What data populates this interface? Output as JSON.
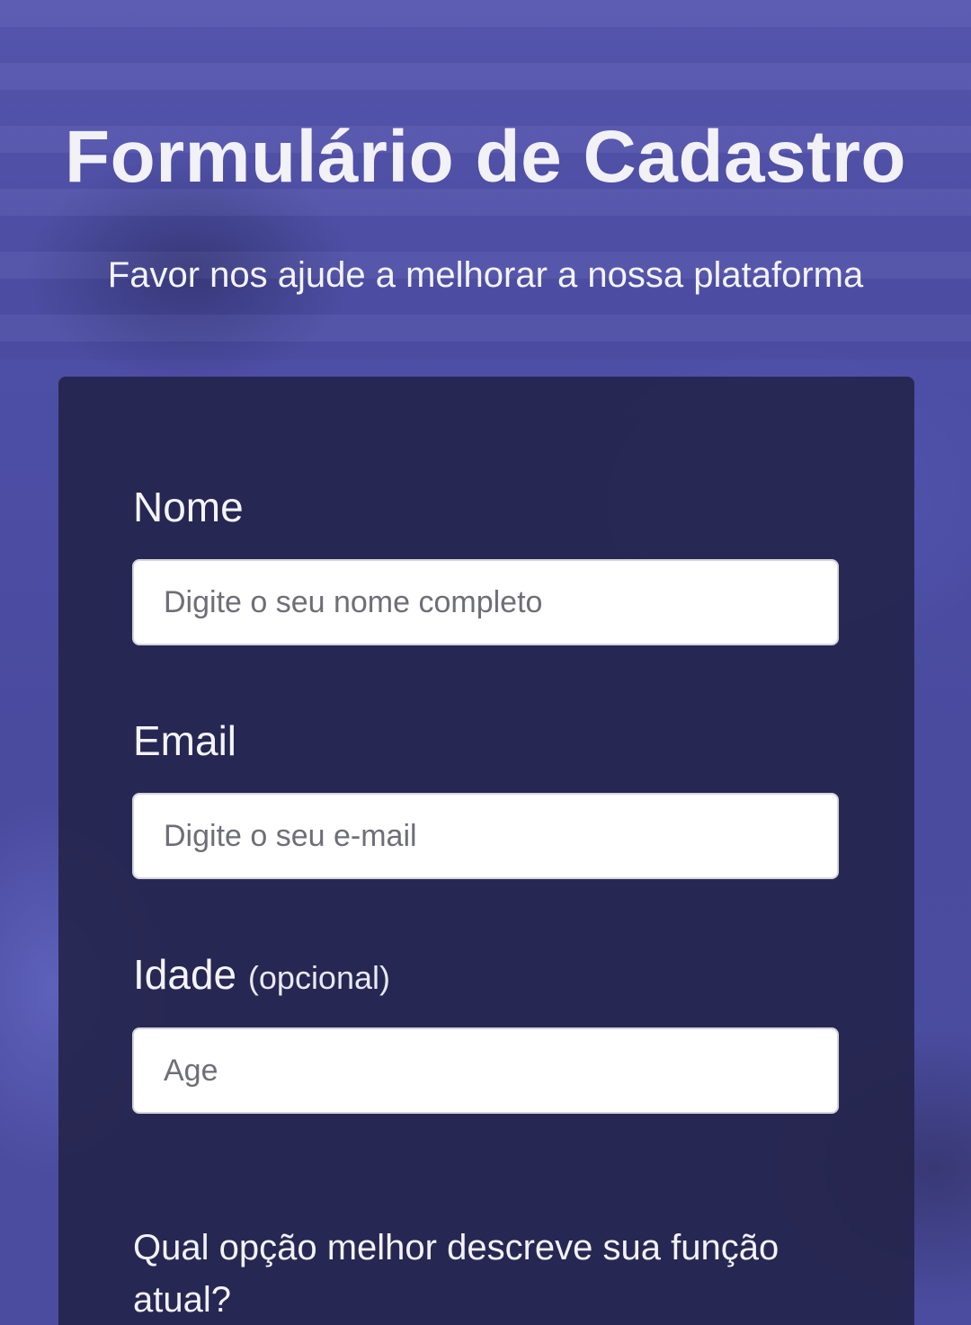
{
  "header": {
    "title": "Formulário de Cadastro",
    "subtitle": "Favor nos ajude a melhorar a nossa plataforma"
  },
  "form": {
    "name": {
      "label": "Nome",
      "placeholder": "Digite o seu nome completo"
    },
    "email": {
      "label": "Email",
      "placeholder": "Digite o seu e-mail"
    },
    "age": {
      "label": "Idade",
      "optional_label": "(opcional)",
      "placeholder": "Age"
    },
    "role_question": "Qual opção melhor descreve sua função atual?"
  },
  "colors": {
    "background": "#4f4fa6",
    "card": "#24244a",
    "text": "#f4f4f8"
  }
}
